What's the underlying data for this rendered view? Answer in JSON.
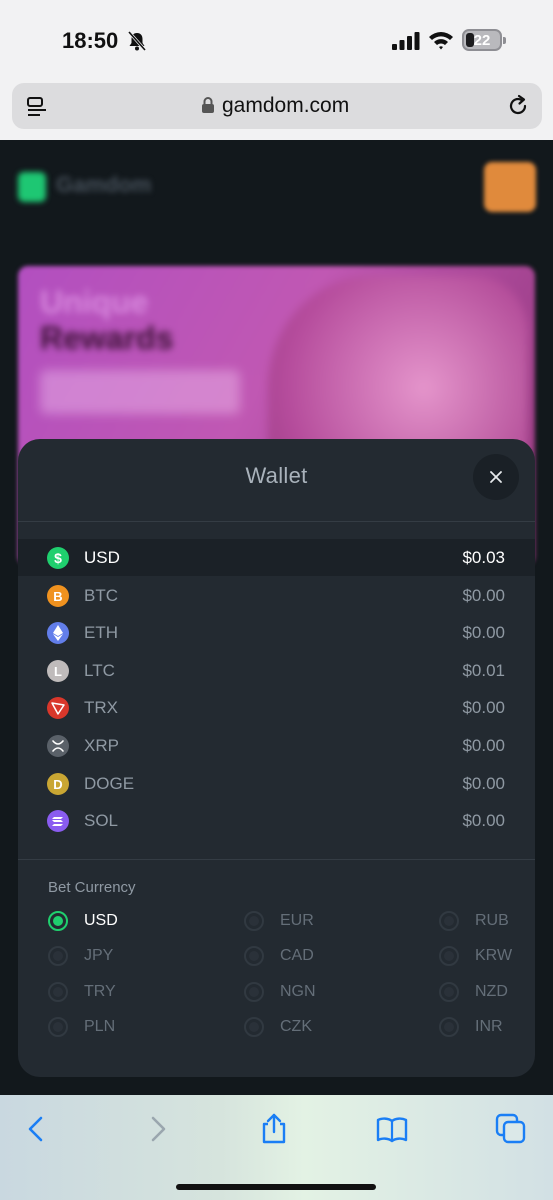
{
  "status_bar": {
    "time": "18:50",
    "battery": "22"
  },
  "browser": {
    "url": "gamdom.com"
  },
  "background_page": {
    "logo_text": "Gamdom",
    "promo_title_line1": "Unique",
    "promo_title_line2": "Rewards"
  },
  "wallet": {
    "title": "Wallet",
    "currencies": [
      {
        "code": "USD",
        "amount": "$0.03",
        "color": "#1fcf6e",
        "icon": "dollar-coin-icon",
        "active": true
      },
      {
        "code": "BTC",
        "amount": "$0.00",
        "color": "#f0921f",
        "icon": "bitcoin-icon"
      },
      {
        "code": "ETH",
        "amount": "$0.00",
        "color": "#627eea",
        "icon": "ethereum-icon"
      },
      {
        "code": "LTC",
        "amount": "$0.01",
        "color": "#bfbbbb",
        "icon": "litecoin-icon"
      },
      {
        "code": "TRX",
        "amount": "$0.00",
        "color": "#d9372b",
        "icon": "tron-icon"
      },
      {
        "code": "XRP",
        "amount": "$0.00",
        "color": "#5a6169",
        "icon": "xrp-icon"
      },
      {
        "code": "DOGE",
        "amount": "$0.00",
        "color": "#c9a633",
        "icon": "dogecoin-icon"
      },
      {
        "code": "SOL",
        "amount": "$0.00",
        "color": "#8a5cf0",
        "icon": "solana-icon"
      }
    ],
    "bet_currency_title": "Bet Currency",
    "bet_currencies": [
      {
        "code": "USD",
        "selected": true
      },
      {
        "code": "EUR"
      },
      {
        "code": "RUB"
      },
      {
        "code": "JPY"
      },
      {
        "code": "CAD"
      },
      {
        "code": "KRW"
      },
      {
        "code": "TRY"
      },
      {
        "code": "NGN"
      },
      {
        "code": "NZD"
      },
      {
        "code": "PLN"
      },
      {
        "code": "CZK"
      },
      {
        "code": "INR"
      }
    ]
  },
  "colors": {
    "accent": "#1fcf6e",
    "modal_bg": "#232a31",
    "safari_blue": "#1a7ef5"
  }
}
